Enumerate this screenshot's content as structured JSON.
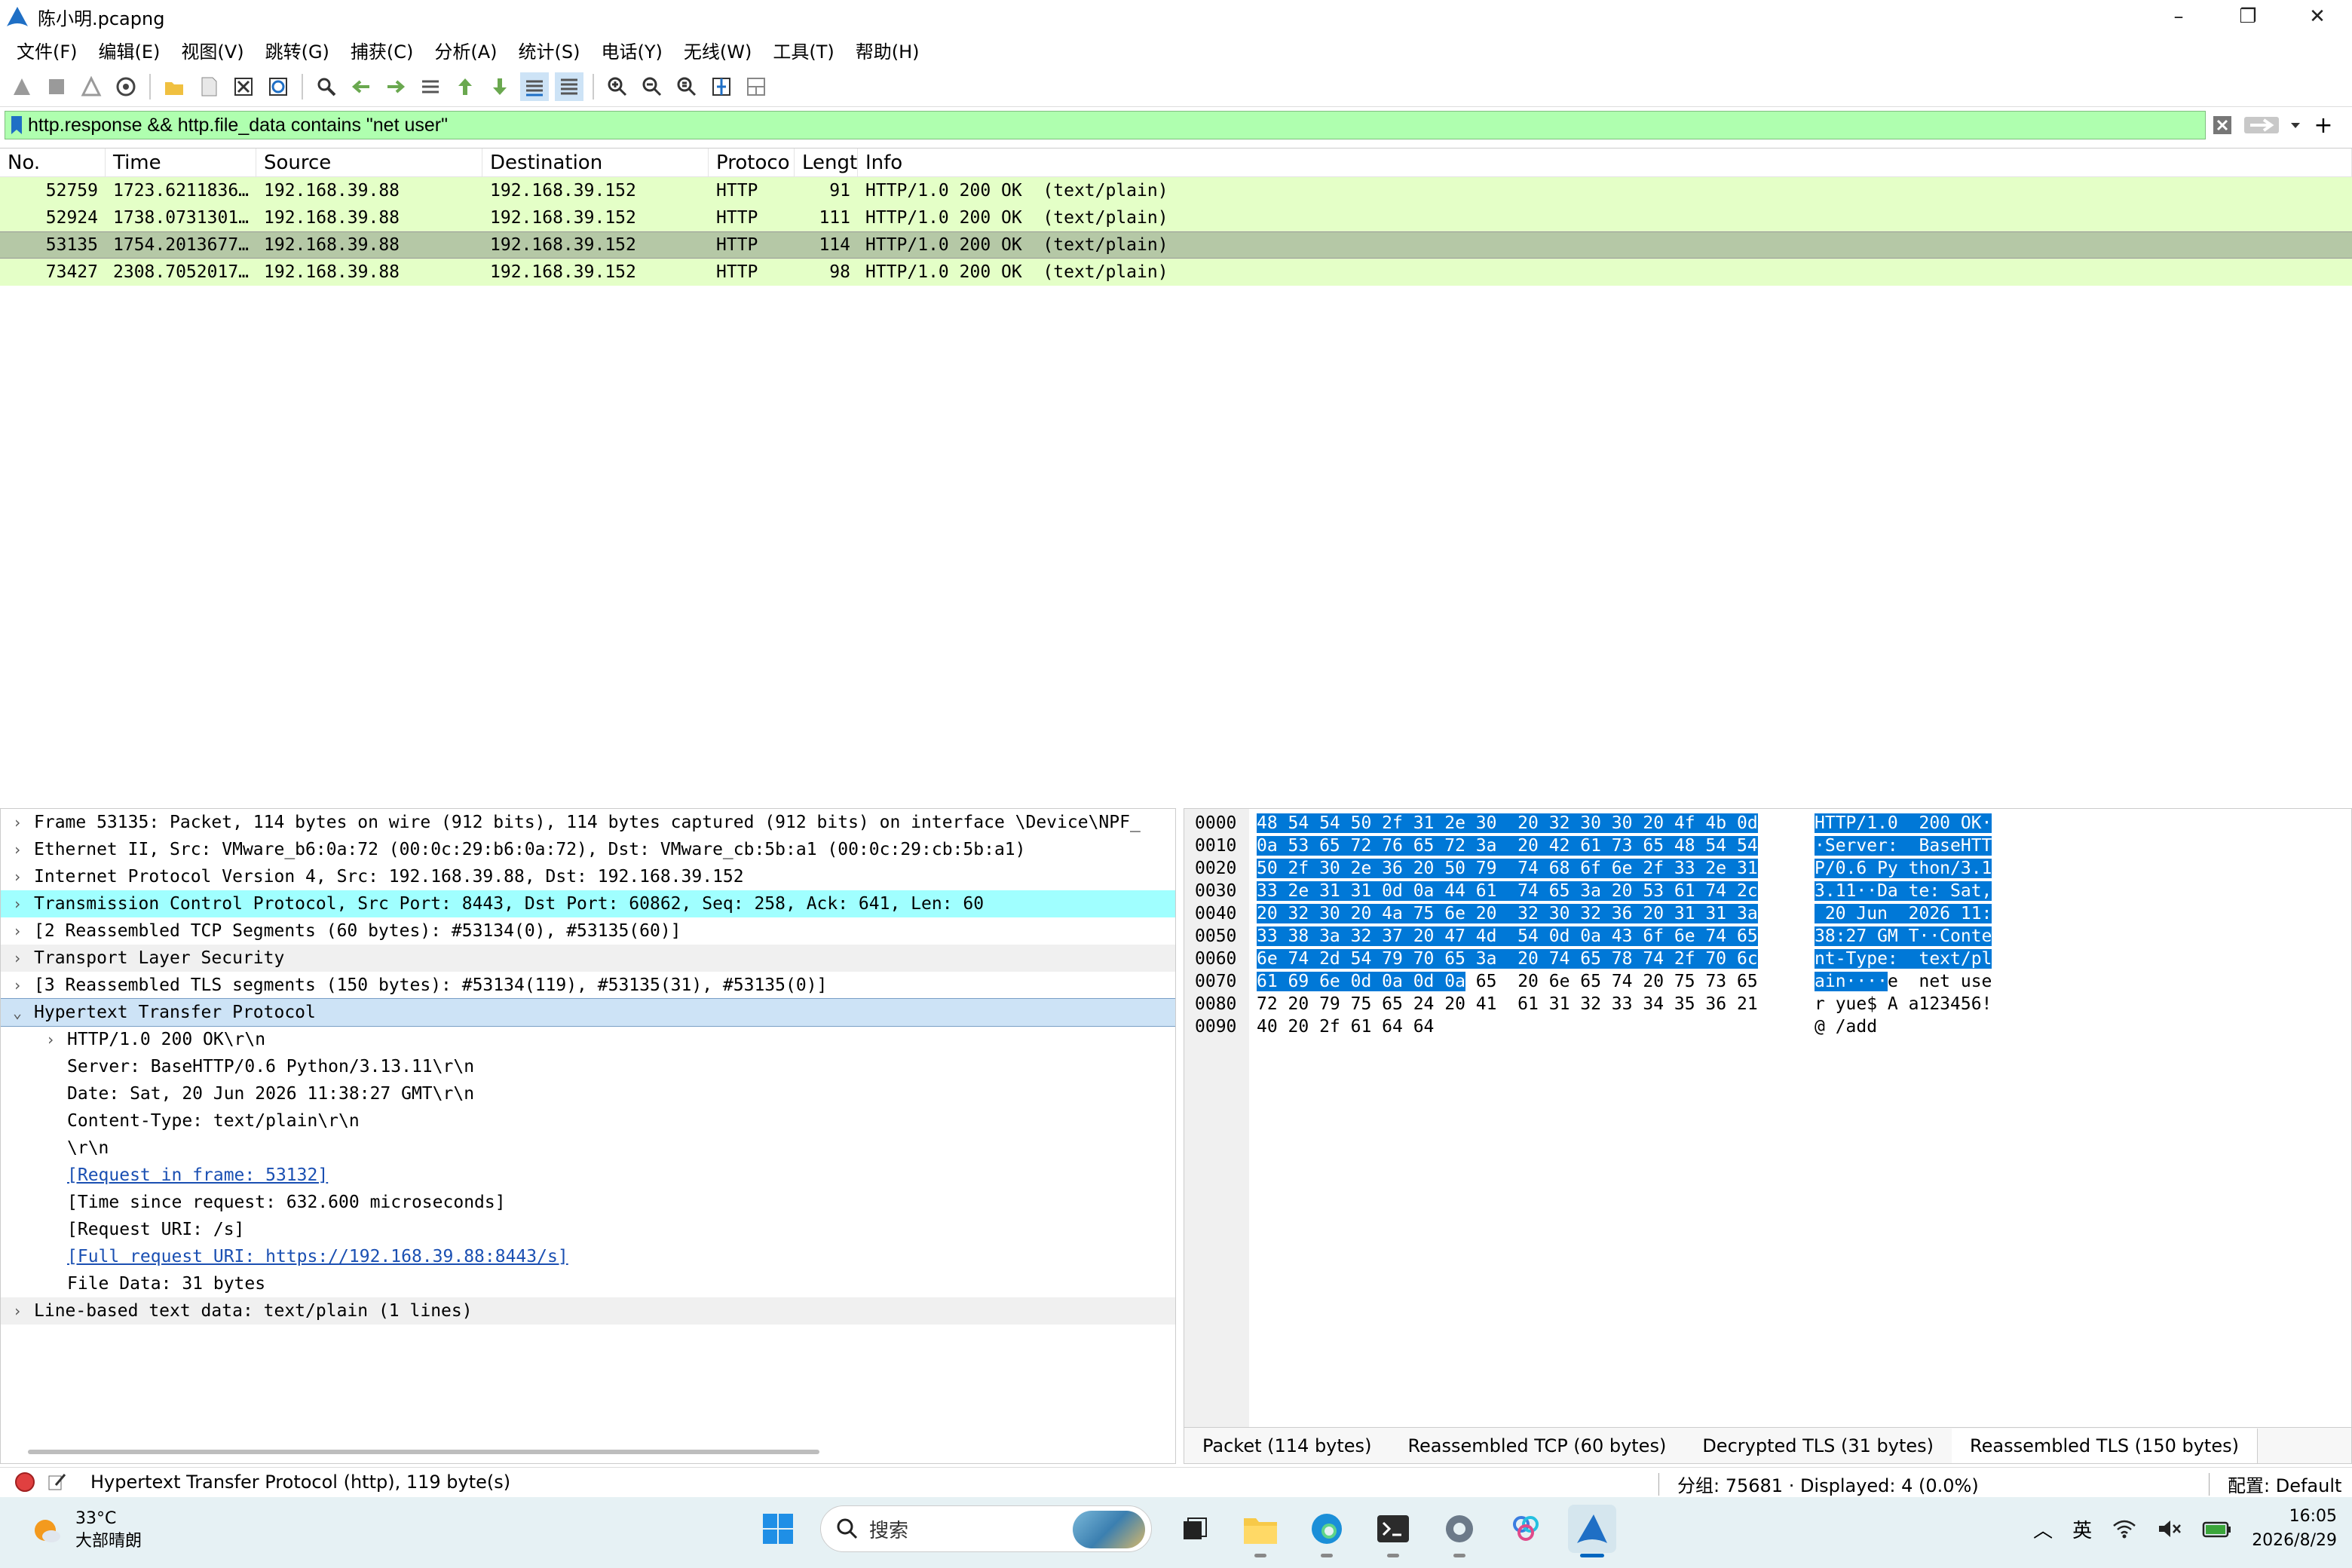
{
  "window": {
    "title": "陈小明.pcapng"
  },
  "menu": [
    "文件(F)",
    "编辑(E)",
    "视图(V)",
    "跳转(G)",
    "捕获(C)",
    "分析(A)",
    "统计(S)",
    "电话(Y)",
    "无线(W)",
    "工具(T)",
    "帮助(H)"
  ],
  "filter": {
    "value": "http.response && http.file_data contains \"net user\""
  },
  "columns": {
    "no": "No.",
    "time": "Time",
    "source": "Source",
    "destination": "Destination",
    "protocol": "Protoco",
    "length": "Lengt",
    "info": "Info"
  },
  "packets": [
    {
      "no": "52759",
      "time": "1723.6211836…",
      "source": "192.168.39.88",
      "destination": "192.168.39.152",
      "protocol": "HTTP",
      "length": "91",
      "info": "HTTP/1.0 200 OK  (text/plain)"
    },
    {
      "no": "52924",
      "time": "1738.0731301…",
      "source": "192.168.39.88",
      "destination": "192.168.39.152",
      "protocol": "HTTP",
      "length": "111",
      "info": "HTTP/1.0 200 OK  (text/plain)"
    },
    {
      "no": "53135",
      "time": "1754.2013677…",
      "source": "192.168.39.88",
      "destination": "192.168.39.152",
      "protocol": "HTTP",
      "length": "114",
      "info": "HTTP/1.0 200 OK  (text/plain)"
    },
    {
      "no": "73427",
      "time": "2308.7052017…",
      "source": "192.168.39.88",
      "destination": "192.168.39.152",
      "protocol": "HTTP",
      "length": "98",
      "info": "HTTP/1.0 200 OK  (text/plain)"
    }
  ],
  "details": {
    "frame": "Frame 53135: Packet, 114 bytes on wire (912 bits), 114 bytes captured (912 bits) on interface \\Device\\NPF_",
    "ethernet": "Ethernet II, Src: VMware_b6:0a:72 (00:0c:29:b6:0a:72), Dst: VMware_cb:5b:a1 (00:0c:29:cb:5b:a1)",
    "ip": "Internet Protocol Version 4, Src: 192.168.39.88, Dst: 192.168.39.152",
    "tcp": "Transmission Control Protocol, Src Port: 8443, Dst Port: 60862, Seq: 258, Ack: 641, Len: 60",
    "reassembled_tcp": "[2 Reassembled TCP Segments (60 bytes): #53134(0), #53135(60)]",
    "tls": "Transport Layer Security",
    "reassembled_tls": "[3 Reassembled TLS segments (150 bytes): #53134(119), #53135(31), #53135(0)]",
    "http": "Hypertext Transfer Protocol",
    "http_status": "HTTP/1.0 200 OK\\r\\n",
    "http_server": "Server: BaseHTTP/0.6 Python/3.13.11\\r\\n",
    "http_date": "Date: Sat, 20 Jun 2026 11:38:27 GMT\\r\\n",
    "http_ctype": "Content-Type: text/plain\\r\\n",
    "http_crlf": "\\r\\n",
    "http_req_frame": "[Request in frame: 53132]",
    "http_time": "[Time since request: 632.600 microseconds]",
    "http_req_uri": "[Request URI: /s]",
    "http_full_uri": "[Full request URI: https://192.168.39.88:8443/s]",
    "http_filedata": "File Data: 31 bytes",
    "linebased": "Line-based text data: text/plain (1 lines)"
  },
  "bytes": {
    "rows": [
      {
        "off": "0000",
        "hex_hl": "48 54 54 50 2f 31 2e 30  20 32 30 30 20 4f 4b 0d",
        "hex": "",
        "asc_hl": "HTTP/1.0  200 OK·",
        "asc": ""
      },
      {
        "off": "0010",
        "hex_hl": "0a 53 65 72 76 65 72 3a  20 42 61 73 65 48 54 54",
        "hex": "",
        "asc_hl": "·Server:  BaseHTT",
        "asc": ""
      },
      {
        "off": "0020",
        "hex_hl": "50 2f 30 2e 36 20 50 79  74 68 6f 6e 2f 33 2e 31",
        "hex": "",
        "asc_hl": "P/0.6 Py thon/3.1",
        "asc": ""
      },
      {
        "off": "0030",
        "hex_hl": "33 2e 31 31 0d 0a 44 61  74 65 3a 20 53 61 74 2c",
        "hex": "",
        "asc_hl": "3.11··Da te: Sat,",
        "asc": ""
      },
      {
        "off": "0040",
        "hex_hl": "20 32 30 20 4a 75 6e 20  32 30 32 36 20 31 31 3a",
        "hex": "",
        "asc_hl": " 20 Jun  2026 11:",
        "asc": ""
      },
      {
        "off": "0050",
        "hex_hl": "33 38 3a 32 37 20 47 4d  54 0d 0a 43 6f 6e 74 65",
        "hex": "",
        "asc_hl": "38:27 GM T··Conte",
        "asc": ""
      },
      {
        "off": "0060",
        "hex_hl": "6e 74 2d 54 79 70 65 3a  20 74 65 78 74 2f 70 6c",
        "hex": "",
        "asc_hl": "nt-Type:  text/pl",
        "asc": ""
      },
      {
        "off": "0070",
        "hex_hl": "61 69 6e 0d 0a 0d 0a",
        "hex": " 65  20 6e 65 74 20 75 73 65",
        "asc_hl": "ain····",
        "asc": "e  net use"
      },
      {
        "off": "0080",
        "hex_hl": "",
        "hex": "72 20 79 75 65 24 20 41  61 31 32 33 34 35 36 21",
        "asc_hl": "",
        "asc": "r yue$ A a123456!"
      },
      {
        "off": "0090",
        "hex_hl": "",
        "hex": "40 20 2f 61 64 64",
        "asc_hl": "",
        "asc": "@ /add"
      }
    ],
    "tabs": [
      "Packet (114 bytes)",
      "Reassembled TCP (60 bytes)",
      "Decrypted TLS (31 bytes)",
      "Reassembled TLS (150 bytes)"
    ]
  },
  "status": {
    "field": "Hypertext Transfer Protocol (http), 119 byte(s)",
    "packets": "分组: 75681 · Displayed: 4 (0.0%)",
    "profile": "配置: Default"
  },
  "taskbar": {
    "temp": "33°C",
    "weather": "大部晴朗",
    "search_placeholder": "搜索",
    "ime": "英",
    "time": "16:05",
    "date": "2026/8/29"
  },
  "colors": {
    "filter_ok": "#afffaf",
    "packet_row": "#e4ffc7",
    "selected_row": "#b5c8a6",
    "tcp_line": "#a0ffff",
    "byte_highlight": "#0078d7"
  }
}
